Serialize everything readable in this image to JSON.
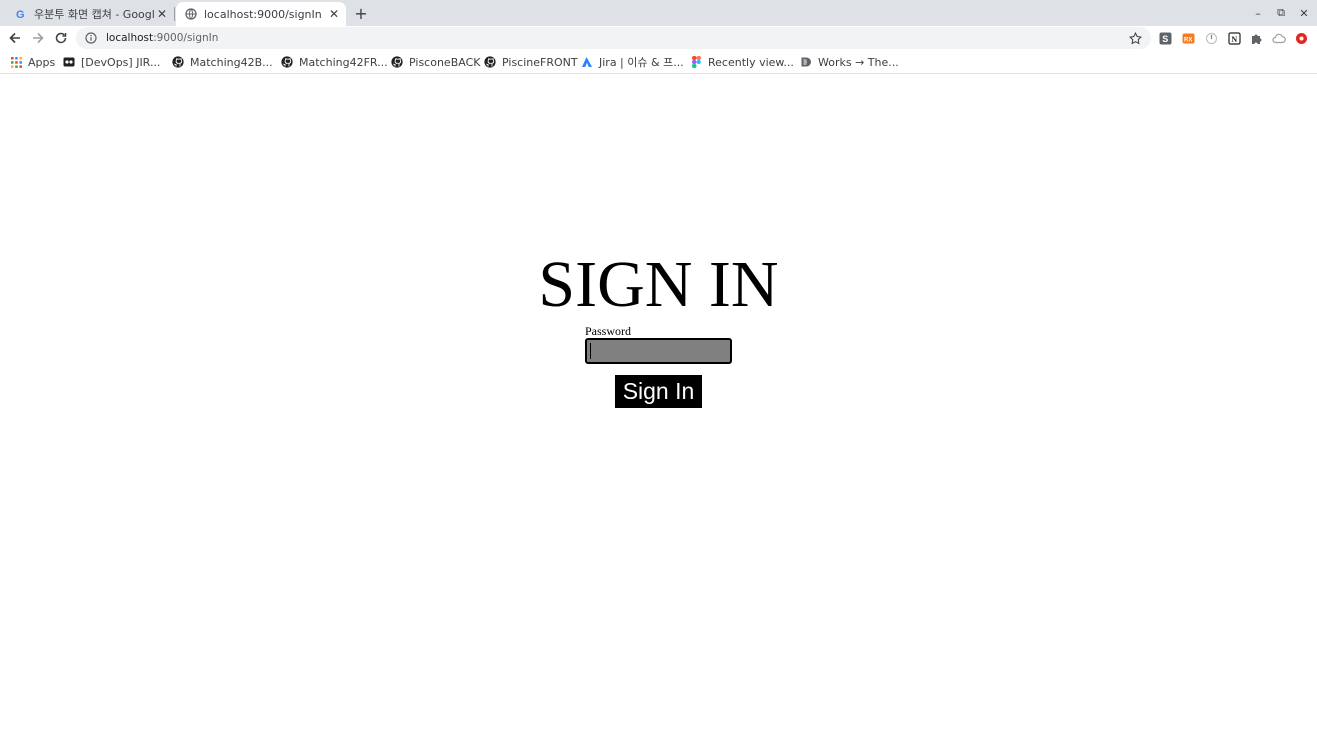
{
  "browser": {
    "tabs": [
      {
        "title": "우분투 화면 캡쳐 - Google 검",
        "favicon": "google-icon",
        "active": false
      },
      {
        "title": "localhost:9000/signIn",
        "favicon": "globe-icon",
        "active": true
      }
    ],
    "new_tab_label": "+",
    "window_controls": {
      "minimize": "–",
      "restore": "⧉",
      "close": "✕"
    },
    "url_host": "localhost",
    "url_path": ":9000/signIn",
    "bookmarks": [
      {
        "label": "Apps",
        "icon": "apps-grid-icon"
      },
      {
        "label": "[DevOps] JIR...",
        "icon": "devops-icon"
      },
      {
        "label": "Matching42B...",
        "icon": "github-icon"
      },
      {
        "label": "Matching42FR...",
        "icon": "github-icon"
      },
      {
        "label": "PisconeBACK",
        "icon": "github-icon"
      },
      {
        "label": "PiscineFRONT",
        "icon": "github-icon"
      },
      {
        "label": "Jira | 이슈 & 프...",
        "icon": "jira-icon"
      },
      {
        "label": "Recently view...",
        "icon": "figma-icon"
      },
      {
        "label": "Works → The...",
        "icon": "works-icon"
      }
    ],
    "extensions": [
      "s-extension-icon",
      "rx-extension-icon",
      "circle-extension-icon",
      "notion-extension-icon",
      "puzzle-icon",
      "cloud-icon",
      "record-icon"
    ]
  },
  "page": {
    "title": "SIGN IN",
    "password_label": "Password",
    "password_value": "",
    "submit_label": "Sign In"
  },
  "colors": {
    "input_bg": "#808080",
    "button_bg": "#000000",
    "button_text": "#ffffff"
  }
}
